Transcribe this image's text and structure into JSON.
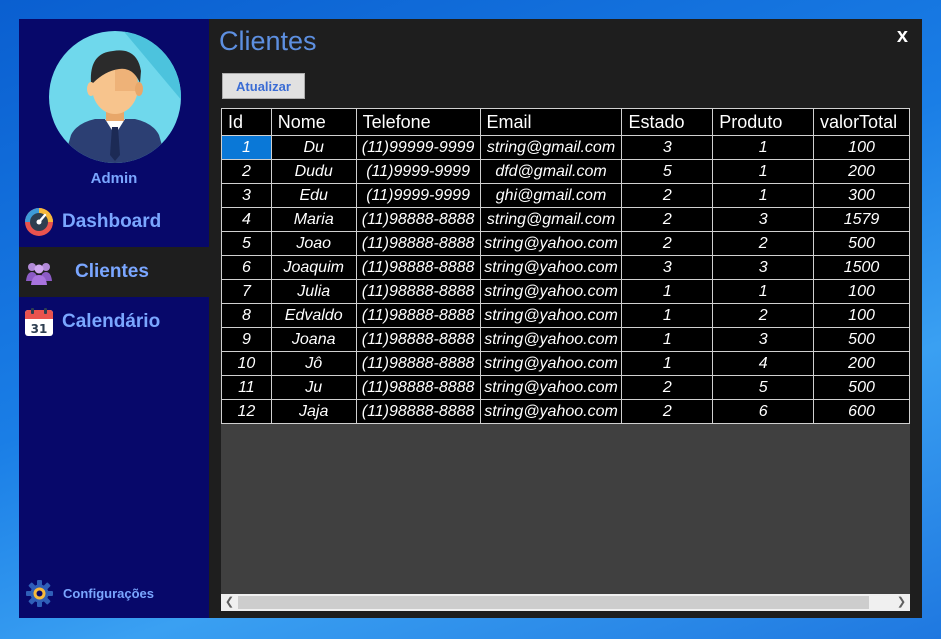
{
  "sidebar": {
    "user_label": "Admin",
    "items": [
      {
        "label": "Dashboard"
      },
      {
        "label": "Clientes"
      },
      {
        "label": "Calendário",
        "icon_text": "31"
      }
    ],
    "settings_label": "Configurações"
  },
  "main": {
    "title": "Clientes",
    "close_label": "x",
    "refresh_label": "Atualizar"
  },
  "table": {
    "columns": [
      "Id",
      "Nome",
      "Telefone",
      "Email",
      "Estado",
      "Produto",
      "valorTotal"
    ],
    "rows": [
      [
        "1",
        "Du",
        "(11)99999-9999",
        "string@gmail.com",
        "3",
        "1",
        "100"
      ],
      [
        "2",
        "Dudu",
        "(11)9999-9999",
        "dfd@gmail.com",
        "5",
        "1",
        "200"
      ],
      [
        "3",
        "Edu",
        "(11)9999-9999",
        "ghi@gmail.com",
        "2",
        "1",
        "300"
      ],
      [
        "4",
        "Maria",
        "(11)98888-8888",
        "string@gmail.com",
        "2",
        "3",
        "1579"
      ],
      [
        "5",
        "Joao",
        "(11)98888-8888",
        "string@yahoo.com",
        "2",
        "2",
        "500"
      ],
      [
        "6",
        "Joaquim",
        "(11)98888-8888",
        "string@yahoo.com",
        "3",
        "3",
        "1500"
      ],
      [
        "7",
        "Julia",
        "(11)98888-8888",
        "string@yahoo.com",
        "1",
        "1",
        "100"
      ],
      [
        "8",
        "Edvaldo",
        "(11)98888-8888",
        "string@yahoo.com",
        "1",
        "2",
        "100"
      ],
      [
        "9",
        "Joana",
        "(11)98888-8888",
        "string@yahoo.com",
        "1",
        "3",
        "500"
      ],
      [
        "10",
        "Jô",
        "(11)98888-8888",
        "string@yahoo.com",
        "1",
        "4",
        "200"
      ],
      [
        "11",
        "Ju",
        "(11)98888-8888",
        "string@yahoo.com",
        "2",
        "5",
        "500"
      ],
      [
        "12",
        "Jaja",
        "(11)98888-8888",
        "string@yahoo.com",
        "2",
        "6",
        "600"
      ]
    ],
    "selected_row": 0
  },
  "colors": {
    "sidebar_bg": "#07086a",
    "accent_text": "#7aa6ff",
    "title": "#5d8fe0",
    "selection": "#0a78d7"
  },
  "icons": {
    "dashboard": "speedometer-icon",
    "clientes": "users-group-icon",
    "calendario": "calendar-icon",
    "settings": "gear-icon",
    "scroll_left": "chevron-left-icon",
    "scroll_right": "chevron-right-icon"
  }
}
